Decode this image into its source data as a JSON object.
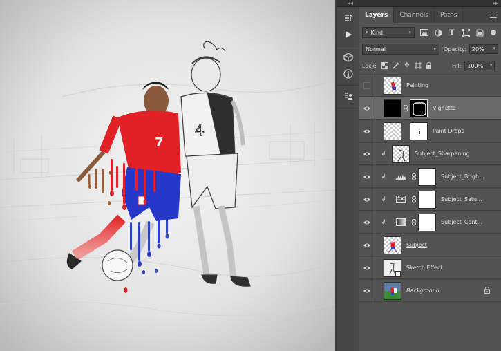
{
  "panel": {
    "tabs": [
      {
        "label": "Layers",
        "active": true
      },
      {
        "label": "Channels",
        "active": false
      },
      {
        "label": "Paths",
        "active": false
      }
    ],
    "filter": {
      "kind_label": "Kind"
    },
    "blend": {
      "mode": "Normal",
      "opacity_label": "Opacity:",
      "opacity": "20%"
    },
    "lock": {
      "label": "Lock:",
      "fill_label": "Fill:",
      "fill": "100%"
    }
  },
  "layers": [
    {
      "name": "Painting",
      "visible": false,
      "thumb": "painting"
    },
    {
      "name": "Vignette",
      "visible": true,
      "selected": true,
      "thumb": "black",
      "mask": "vignette"
    },
    {
      "name": "Paint Drops",
      "visible": true,
      "thumb": "transparent",
      "mask": "white"
    },
    {
      "name": "Subject_Sharpening",
      "visible": true,
      "clipped": true,
      "thumb": "sketch"
    },
    {
      "name": "Subject_Brigh...",
      "visible": true,
      "clipped": true,
      "adjust": "levels",
      "mask": "white"
    },
    {
      "name": "Subject_Satu...",
      "visible": true,
      "clipped": true,
      "adjust": "hue-sat",
      "mask": "white"
    },
    {
      "name": "Subject_Cont...",
      "visible": true,
      "clipped": true,
      "adjust": "gradient",
      "mask": "white"
    },
    {
      "name": "Subject",
      "visible": true,
      "thumb": "subject",
      "style": "underline"
    },
    {
      "name": "Sketch Effect",
      "visible": true,
      "thumb": "sketch-effect"
    },
    {
      "name": "Background",
      "visible": true,
      "thumb": "photo",
      "style": "italic",
      "locked": true
    }
  ],
  "colors": {
    "accent_red": "#e0202c",
    "kit_blue": "#2a3fc4",
    "panel": "#535353"
  }
}
